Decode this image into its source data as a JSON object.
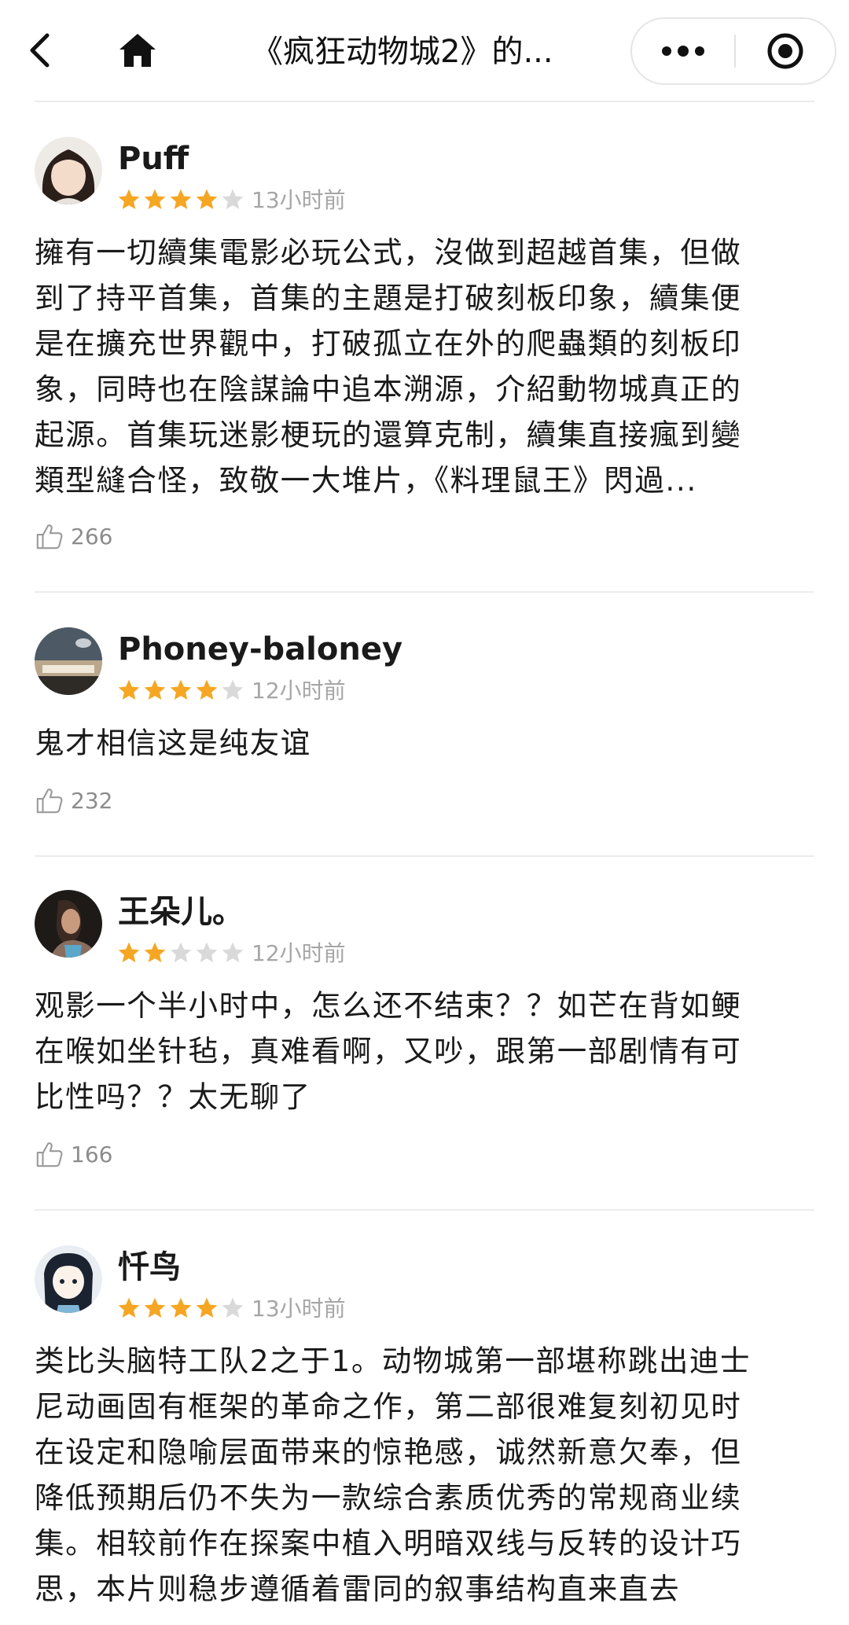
{
  "nav": {
    "title": "《疯狂动物城2》的...",
    "icons": [
      "back-icon",
      "home-icon",
      "more-icon",
      "close-target-icon"
    ]
  },
  "colors": {
    "star_on": "#F5A623",
    "star_off": "#D9D9D9",
    "meta": "#A6A6A6"
  },
  "reviews": [
    {
      "user": "Puff",
      "rating": 4,
      "time": "13小时前",
      "lines": [
        "擁有一切續集電影必玩公式，沒做到超越首集，但做",
        "到了持平首集，首集的主題是打破刻板印象，續集便",
        "是在擴充世界觀中，打破孤立在外的爬蟲類的刻板印",
        "象，同時也在陰謀論中追本溯源，介紹動物城真正的",
        "起源。首集玩迷影梗玩的還算克制，續集直接瘋到變",
        "類型縫合怪，致敬一大堆片，《料理鼠王》閃過..."
      ],
      "likes": "266"
    },
    {
      "user": "Phoney-baloney",
      "rating": 4,
      "time": "12小时前",
      "lines": [
        "鬼才相信这是纯友谊"
      ],
      "likes": "232"
    },
    {
      "user": "王朵儿。",
      "rating": 2,
      "time": "12小时前",
      "lines": [
        "观影一个半小时中，怎么还不结束？？如芒在背如鲠",
        "在喉如坐针毡，真难看啊，又吵，跟第一部剧情有可",
        "比性吗？？太无聊了"
      ],
      "likes": "166"
    },
    {
      "user": "忏鸟",
      "rating": 4,
      "time": "13小时前",
      "lines": [
        "类比头脑特工队2之于1。动物城第一部堪称跳出迪士",
        "尼动画固有框架的革命之作，第二部很难复刻初见时",
        "在设定和隐喻层面带来的惊艳感，诚然新意欠奉，但",
        "降低预期后仍不失为一款综合素质优秀的常规商业续",
        "集。相较前作在探案中植入明暗双线与反转的设计巧",
        "思，本片则稳步遵循着雷同的叙事结构直来直去"
      ],
      "likes": ""
    }
  ]
}
